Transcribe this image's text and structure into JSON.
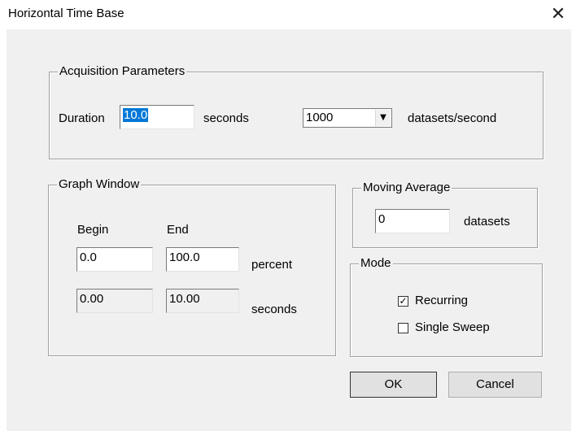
{
  "window": {
    "title": "Horizontal Time Base"
  },
  "acquisition": {
    "legend": "Acquisition Parameters",
    "duration_label": "Duration",
    "duration_value": "10.0",
    "seconds_label": "seconds",
    "rate_value": "1000",
    "rate_unit": "datasets/second"
  },
  "graph_window": {
    "legend": "Graph Window",
    "begin_label": "Begin",
    "end_label": "End",
    "begin_percent": "0.0",
    "end_percent": "100.0",
    "percent_label": "percent",
    "begin_seconds": "0.00",
    "end_seconds": "10.00",
    "seconds_label": "seconds"
  },
  "moving_average": {
    "legend": "Moving Average",
    "value": "0",
    "unit": "datasets"
  },
  "mode": {
    "legend": "Mode",
    "options": [
      {
        "label": "Recurring",
        "checked": true
      },
      {
        "label": "Single Sweep",
        "checked": false
      }
    ]
  },
  "buttons": {
    "ok": "OK",
    "cancel": "Cancel"
  }
}
